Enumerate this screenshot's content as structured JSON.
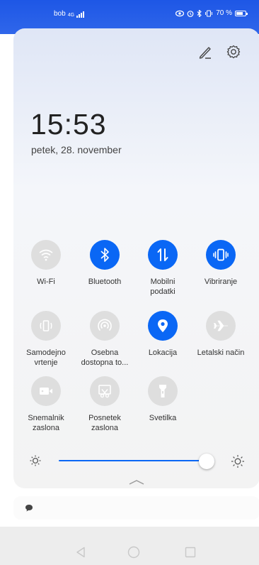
{
  "status_bar": {
    "carrier": "bob",
    "network_type": "4G",
    "battery_percent": "70 %",
    "icons": [
      "signal-icon",
      "eye-icon",
      "alarm-icon",
      "bluetooth-icon",
      "vibrate-icon",
      "battery-icon"
    ]
  },
  "panel": {
    "time": "15:53",
    "date": "petek, 28. november"
  },
  "tiles": [
    {
      "label": "Wi-Fi",
      "active": false,
      "icon": "wifi-icon"
    },
    {
      "label": "Bluetooth",
      "active": true,
      "icon": "bluetooth-icon"
    },
    {
      "label": "Mobilni\npodatki",
      "active": true,
      "icon": "mobile-data-icon"
    },
    {
      "label": "Vibriranje",
      "active": true,
      "icon": "vibrate-icon"
    },
    {
      "label": "Samodejno\nvrtenje",
      "active": false,
      "icon": "auto-rotate-icon"
    },
    {
      "label": "Osebna\ndostopna to...",
      "active": false,
      "icon": "hotspot-icon"
    },
    {
      "label": "Lokacija",
      "active": true,
      "icon": "location-icon"
    },
    {
      "label": "Letalski način",
      "active": false,
      "icon": "airplane-icon"
    },
    {
      "label": "Snemalnik\nzaslona",
      "active": false,
      "icon": "screen-recorder-icon"
    },
    {
      "label": "Posnetek\nzaslona",
      "active": false,
      "icon": "screenshot-icon"
    },
    {
      "label": "Svetilka",
      "active": false,
      "icon": "flashlight-icon"
    }
  ],
  "brightness": {
    "level": 0.95
  },
  "colors": {
    "accent": "#0a67f5",
    "status_bar": "#1e57e6",
    "tile_off": "#dedede"
  }
}
